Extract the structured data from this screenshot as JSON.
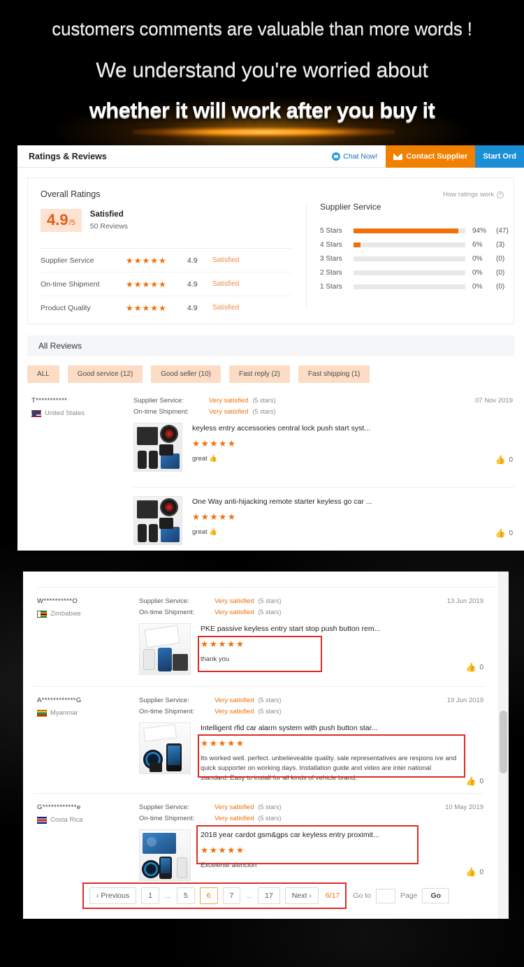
{
  "hero": {
    "line1": "customers comments are valuable than more words !",
    "line2": "We understand you're worried about",
    "line3": "whether it will work after you buy it"
  },
  "header": {
    "title": "Ratings & Reviews",
    "chat_now": "Chat Now!",
    "contact_supplier": "Contact Supplier",
    "start_order": "Start Ord"
  },
  "overall": {
    "title": "Overall Ratings",
    "how_ratings_work": "How ratings work",
    "how_icon": "?",
    "score": "4.9",
    "score_denominator": "/5",
    "score_label": "Satisfied",
    "reviews_count": "50 Reviews",
    "metrics": [
      {
        "name": "Supplier Service",
        "stars": "★★★★★",
        "value": "4.9",
        "tag": "Satisfied"
      },
      {
        "name": "On-time Shipment",
        "stars": "★★★★★",
        "value": "4.9",
        "tag": "Satisfied"
      },
      {
        "name": "Product Quality",
        "stars": "★★★★★",
        "value": "4.9",
        "tag": "Satisfied"
      }
    ]
  },
  "supplier_service": {
    "title": "Supplier Service",
    "bars": [
      {
        "label": "5 Stars",
        "percent": "94%",
        "count": "(47)",
        "width": 94
      },
      {
        "label": "4 Stars",
        "percent": "6%",
        "count": "(3)",
        "width": 6
      },
      {
        "label": "3 Stars",
        "percent": "0%",
        "count": "(0)",
        "width": 0
      },
      {
        "label": "2 Stars",
        "percent": "0%",
        "count": "(0)",
        "width": 0
      },
      {
        "label": "1 Stars",
        "percent": "0%",
        "count": "(0)",
        "width": 0
      }
    ]
  },
  "all_reviews": {
    "heading": "All Reviews",
    "filters": [
      {
        "label": "ALL"
      },
      {
        "label": "Good service (12)"
      },
      {
        "label": "Good seller (10)"
      },
      {
        "label": "Fast reply (2)"
      },
      {
        "label": "Fast shipping (1)"
      }
    ]
  },
  "reviews": [
    {
      "name": "T***********",
      "country": "United States",
      "supplier_service_key": "Supplier Service:",
      "supplier_service_val": "Very satisfied",
      "supplier_service_stars": "(5 stars)",
      "shipment_key": "On-time Shipment:",
      "shipment_val": "Very satisfied",
      "shipment_stars": "(5 stars)",
      "date": "07 Nov 2019",
      "items": [
        {
          "title": "keyless entry accessories central lock push start syst...",
          "stars": "★★★★★",
          "text": "great 👍",
          "likes": "0"
        },
        {
          "title": "One Way anti-hijacking remote starter keyless go car ...",
          "stars": "★★★★★",
          "text": "great 👍",
          "likes": "0"
        }
      ]
    },
    {
      "name": "W**********O",
      "country": "Zimbabwe",
      "supplier_service_key": "Supplier Service:",
      "supplier_service_val": "Very satisfied",
      "supplier_service_stars": "(5 stars)",
      "shipment_key": "On-time Shipment:",
      "shipment_val": "Very satisfied",
      "shipment_stars": "(5 stars)",
      "date": "13 Jun 2019",
      "items": [
        {
          "title": "PKE passive keyless entry start stop push button rem...",
          "stars": "★★★★★",
          "text": "thank you",
          "likes": "0"
        }
      ]
    },
    {
      "name": "A************G",
      "country": "Myanmar",
      "supplier_service_key": "Supplier Service:",
      "supplier_service_val": "Very satisfied",
      "supplier_service_stars": "(5 stars)",
      "shipment_key": "On-time Shipment:",
      "shipment_val": "Very satisfied",
      "shipment_stars": "(5 stars)",
      "date": "19 Jun 2019",
      "items": [
        {
          "title": "Intelligent rfid car alarm system with push button star...",
          "stars": "★★★★★",
          "text": "Its worked well. perfect. unbelieveable quality. sale representatives are respons ive and quick supporter on working days. Installation guide and video are  inter national standard. Easy to install for all kinds of vehicle brand.",
          "likes": "0"
        }
      ]
    },
    {
      "name": "G************e",
      "country": "Costa Rica",
      "supplier_service_key": "Supplier Service:",
      "supplier_service_val": "Very satisfied",
      "supplier_service_stars": "(5 stars)",
      "shipment_key": "On-time Shipment:",
      "shipment_val": "Very satisfied",
      "shipment_stars": "(5 stars)",
      "date": "10 May 2019",
      "items": [
        {
          "title": "2018 year cardot gsm&gps car keyless entry proximit...",
          "stars": "★★★★★",
          "text": "Excelente atención",
          "likes": "0"
        }
      ]
    }
  ],
  "pagination": {
    "previous": "‹ Previous",
    "pages": [
      "1",
      "...",
      "5",
      "6",
      "7",
      "...",
      "17"
    ],
    "active_page": "6",
    "next": "Next ›",
    "counter": "6/17",
    "goto_label": "Go to",
    "goto_value": "",
    "page_label": "Page",
    "go_button": "Go"
  },
  "colors": {
    "accent_orange": "#f0700a",
    "contact_orange": "#f28000",
    "start_blue": "#1a8fd6",
    "annotation_red": "#e02b20"
  }
}
